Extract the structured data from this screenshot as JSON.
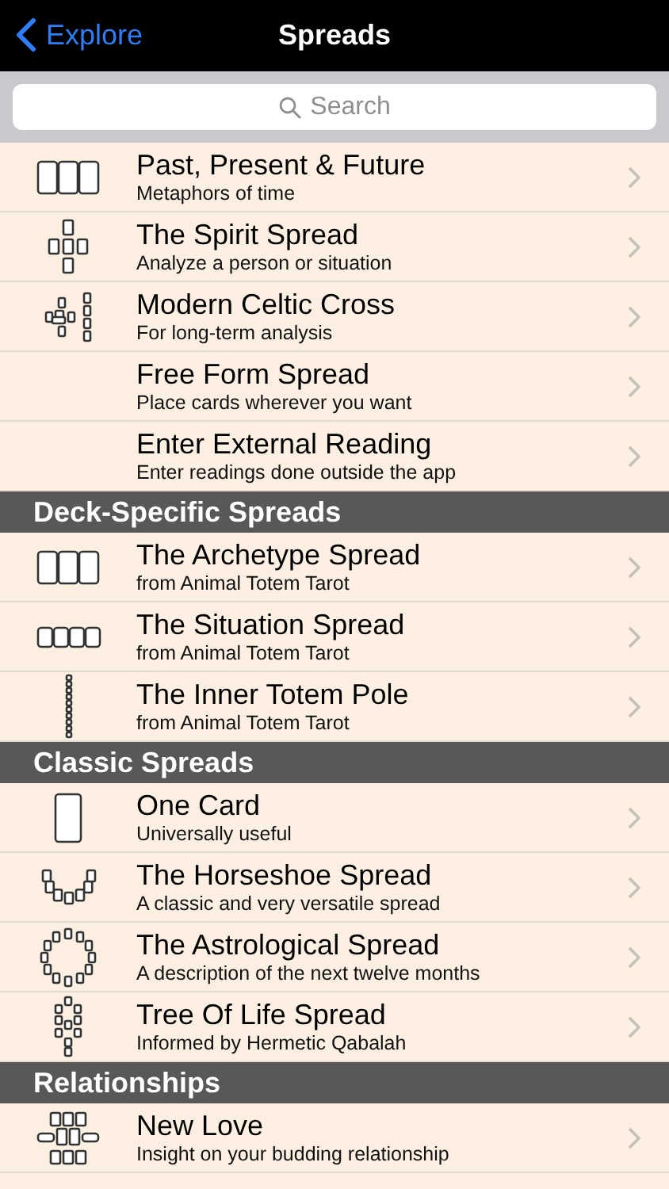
{
  "nav": {
    "back": "Explore",
    "title": "Spreads"
  },
  "search": {
    "placeholder": "Search"
  },
  "sections": [
    {
      "items": [
        {
          "title": "Past, Present & Future",
          "subtitle": "Metaphors of time",
          "kind": "three"
        },
        {
          "title": "The Spirit Spread",
          "subtitle": "Analyze a person or situation",
          "kind": "spirit"
        },
        {
          "title": "Modern Celtic Cross",
          "subtitle": "For long-term analysis",
          "kind": "celtic"
        },
        {
          "title": "Free Form Spread",
          "subtitle": "Place cards wherever you want",
          "kind": "none"
        },
        {
          "title": "Enter External Reading",
          "subtitle": "Enter readings done outside the app",
          "kind": "none"
        }
      ]
    },
    {
      "header": "Deck-Specific Spreads",
      "items": [
        {
          "title": "The Archetype Spread",
          "subtitle": "from Animal Totem Tarot",
          "kind": "three"
        },
        {
          "title": "The Situation Spread",
          "subtitle": "from Animal Totem Tarot",
          "kind": "four"
        },
        {
          "title": "The Inner Totem Pole",
          "subtitle": "from Animal Totem Tarot",
          "kind": "pole"
        }
      ]
    },
    {
      "header": "Classic Spreads",
      "items": [
        {
          "title": "One Card",
          "subtitle": "Universally useful",
          "kind": "one"
        },
        {
          "title": "The Horseshoe Spread",
          "subtitle": "A classic and very versatile spread",
          "kind": "horseshoe"
        },
        {
          "title": "The Astrological Spread",
          "subtitle": "A description of the next twelve months",
          "kind": "astro"
        },
        {
          "title": "Tree Of Life Spread",
          "subtitle": "Informed by Hermetic Qabalah",
          "kind": "tree"
        }
      ]
    },
    {
      "header": "Relationships",
      "items": [
        {
          "title": "New Love",
          "subtitle": "Insight on your budding relationship",
          "kind": "love"
        }
      ]
    }
  ]
}
